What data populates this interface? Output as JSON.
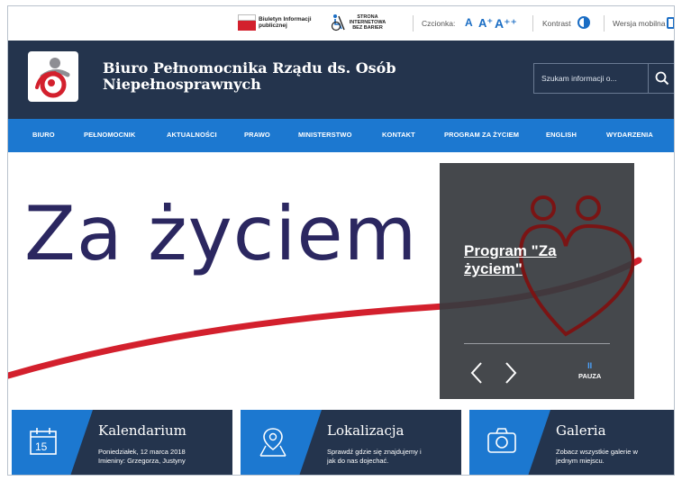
{
  "topbar": {
    "bip_text": "Biuletyn Informacji publicznej",
    "nobar_text": "STRONA INTERNETOWA BEZ BARIER",
    "font_label": "Czcionka:",
    "font_sizes": [
      "A",
      "A⁺",
      "A⁺⁺"
    ],
    "contrast_label": "Kontrast",
    "mobile_label": "Wersja mobilna"
  },
  "header": {
    "title_line1": "Biuro Pełnomocnika Rządu ds. Osób",
    "title_line2": "Niepełnosprawnych",
    "search_placeholder": "Szukam informacji o..."
  },
  "nav": {
    "items": [
      "BIURO",
      "PEŁNOMOCNIK",
      "AKTUALNOŚCI",
      "PRAWO",
      "MINISTERSTWO",
      "KONTAKT",
      "PROGRAM ZA ŻYCIEM",
      "ENGLISH",
      "WYDARZENIA"
    ]
  },
  "hero": {
    "banner_text": "Za życiem",
    "slide_title_line1": "Program \"Za",
    "slide_title_line2": "życiem\"",
    "pause_label": "PAUZA",
    "pause_glyph": "II"
  },
  "cards": [
    {
      "title": "Kalendarium",
      "desc_line1": "Poniedziałek, 12 marca 2018",
      "desc_line2": "Imieniny: Grzegorza, Justyny",
      "icon_day": "15"
    },
    {
      "title": "Lokalizacja",
      "desc_line1": "Sprawdź gdzie się znajdujemy i",
      "desc_line2": "jak do nas dojechać."
    },
    {
      "title": "Galeria",
      "desc_line1": "Zobacz wszystkie galerie w",
      "desc_line2": "jednym miejscu."
    }
  ],
  "colors": {
    "header_bg": "#24344d",
    "nav_bg": "#1c78d0",
    "accent_red": "#d3202d",
    "banner_text": "#2b2760"
  }
}
